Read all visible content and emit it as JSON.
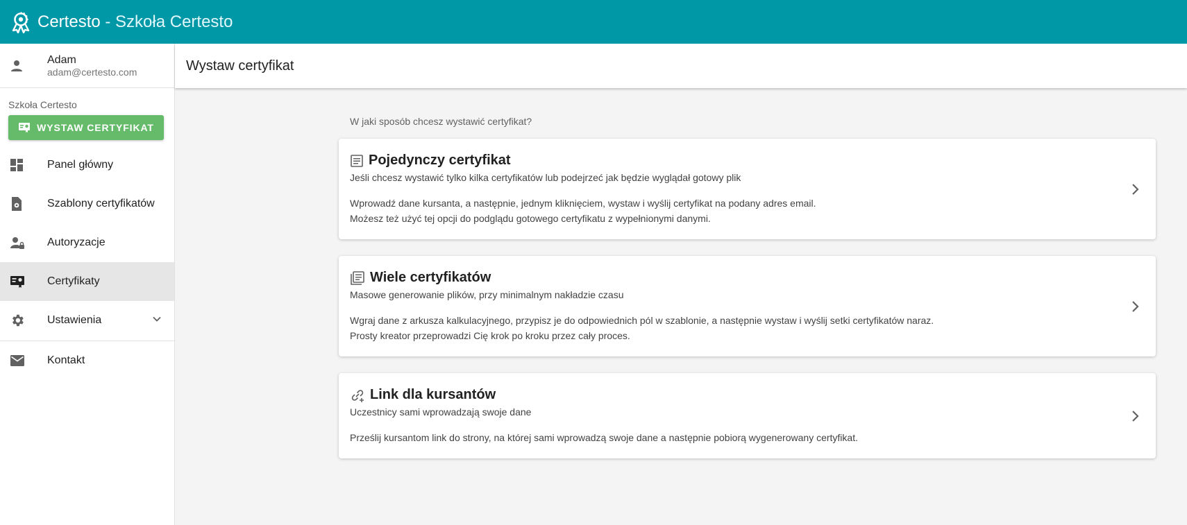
{
  "app": {
    "brand": "Certesto",
    "separator": " - ",
    "school": "Szkoła Certesto"
  },
  "user": {
    "name": "Adam",
    "email": "adam@certesto.com"
  },
  "sidebar": {
    "org": "Szkoła Certesto",
    "issue_button": "WYSTAW CERTYFIKAT",
    "items": [
      {
        "label": "Panel główny",
        "icon": "dashboard-icon"
      },
      {
        "label": "Szablony certyfikatów",
        "icon": "template-icon"
      },
      {
        "label": "Autoryzacje",
        "icon": "user-lock-icon"
      },
      {
        "label": "Certyfikaty",
        "icon": "certificate-icon",
        "active": true
      },
      {
        "label": "Ustawienia",
        "icon": "gear-icon",
        "expandable": true
      }
    ],
    "contact": {
      "label": "Kontakt",
      "icon": "mail-icon"
    }
  },
  "page": {
    "title": "Wystaw certyfikat",
    "question": "W jaki sposób chcesz wystawić certyfikat?"
  },
  "cards": [
    {
      "title": "Pojedynczy certyfikat",
      "subtitle": "Jeśli chcesz wystawić tylko kilka certyfikatów lub podejrzeć jak będzie wyglądał gotowy plik",
      "desc1": "Wprowadź dane kursanta, a następnie, jednym kliknięciem, wystaw i wyślij certyfikat na podany adres email.",
      "desc2": "Możesz też użyć tej opcji do podglądu gotowego certyfikatu z wypełnionymi danymi."
    },
    {
      "title": "Wiele certyfikatów",
      "subtitle": "Masowe generowanie plików, przy minimalnym nakładzie czasu",
      "desc1": "Wgraj dane z arkusza kalkulacyjnego, przypisz je do odpowiednich pól w szablonie, a następnie wystaw i wyślij setki certyfikatów naraz.",
      "desc2": "Prosty kreator przeprowadzi Cię krok po kroku przez cały proces."
    },
    {
      "title": "Link dla kursantów",
      "subtitle": "Uczestnicy sami wprowadzają swoje dane",
      "desc1": "Prześlij kursantom link do strony, na której sami wprowadzą swoje dane a następnie pobiorą wygenerowany certyfikat."
    }
  ],
  "colors": {
    "topbar": "#0097a7",
    "issue_button": "#66bb6a",
    "active_item": "#e6e6e6"
  }
}
